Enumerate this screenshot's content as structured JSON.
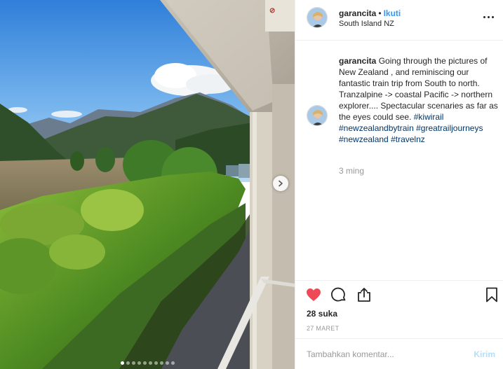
{
  "post": {
    "username": "garancita",
    "separator": "•",
    "follow_label": "Ikuti",
    "location": "South Island NZ",
    "more_icon": "more-horizontal-icon",
    "caption": {
      "username": "garancita",
      "text": "Going through the pictures of New Zealand , and reminiscing our fantastic train trip from South to north. Tranzalpine -> coastal Pacific -> northern explorer.... Spectacular scenaries as far as the eyes could see.",
      "hashtags": [
        "#kiwirail",
        "#newzealandbytrain",
        "#greatrailjourneys",
        "#newzealand",
        "#travelnz"
      ]
    },
    "relative_time": "3 ming",
    "actions": {
      "like_icon": "heart-filled-icon",
      "comment_icon": "comment-icon",
      "share_icon": "share-icon",
      "save_icon": "bookmark-icon"
    },
    "likes": "28 suka",
    "date": "27 MARET",
    "comment_box": {
      "placeholder": "Tambahkan komentar...",
      "post_label": "Kirim"
    },
    "carousel": {
      "total": 10,
      "current": 1
    }
  },
  "colors": {
    "follow": "#3897f0",
    "hashtag": "#003569",
    "like_heart": "#ed4956",
    "post_disabled": "#b2dffc"
  }
}
